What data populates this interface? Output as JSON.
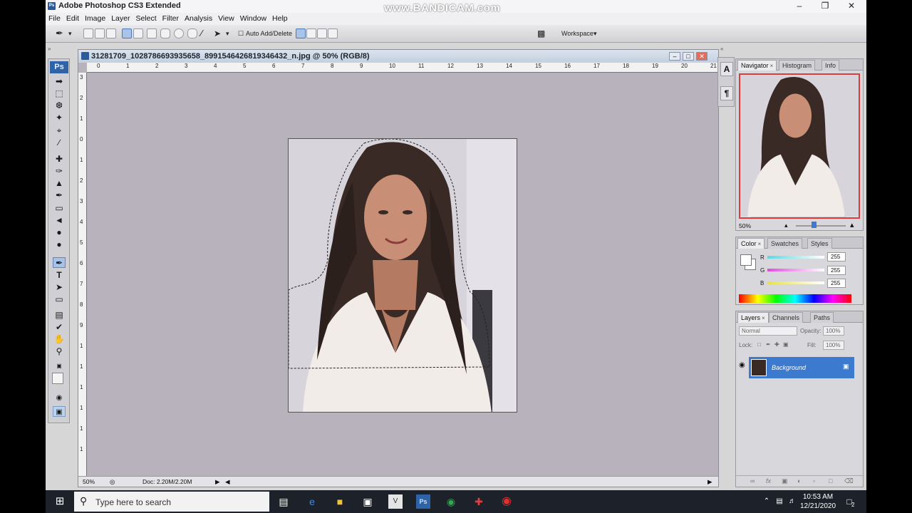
{
  "window": {
    "title": "Adobe Photoshop CS3 Extended",
    "watermark": "www.BANDICAM.com"
  },
  "menu": [
    "File",
    "Edit",
    "Image",
    "Layer",
    "Select",
    "Filter",
    "Analysis",
    "View",
    "Window",
    "Help"
  ],
  "options": {
    "auto_add_delete": "Auto Add/Delete",
    "workspace": "Workspace"
  },
  "toolbox": {
    "logo": "Ps"
  },
  "document": {
    "title": "31281709_1028786693935658_8991546426819346432_n.jpg @ 50% (RGB/8)",
    "zoom": "50%",
    "doc_info": "Doc: 2.20M/2.20M",
    "hruler": [
      "0",
      "1",
      "2",
      "3",
      "4",
      "5",
      "6",
      "7",
      "8",
      "9",
      "10",
      "11",
      "12",
      "13",
      "14",
      "15",
      "16",
      "17",
      "18",
      "19",
      "20",
      "21"
    ],
    "vruler": [
      "3",
      "2",
      "1",
      "0",
      "1",
      "2",
      "3",
      "4",
      "5",
      "6",
      "7",
      "8",
      "9",
      "1",
      "1",
      "1",
      "1",
      "1",
      "1"
    ]
  },
  "dock": {
    "char_icon": "A",
    "para_icon": "¶"
  },
  "navigator": {
    "tabs": [
      "Navigator",
      "Histogram",
      "Info"
    ],
    "zoom": "50%"
  },
  "color": {
    "tabs": [
      "Color",
      "Swatches",
      "Styles"
    ],
    "r_label": "R",
    "g_label": "G",
    "b_label": "B",
    "r": "255",
    "g": "255",
    "b": "255"
  },
  "layers": {
    "tabs": [
      "Layers",
      "Channels",
      "Paths"
    ],
    "blend": "Normal",
    "opacity_label": "Opacity:",
    "opacity": "100%",
    "lock_label": "Lock:",
    "fill_label": "Fill:",
    "fill": "100%",
    "layer_name": "Background"
  },
  "taskbar": {
    "search_placeholder": "Type here to search",
    "time": "10:53 AM",
    "date": "12/21/2020",
    "notif_count": "2"
  }
}
